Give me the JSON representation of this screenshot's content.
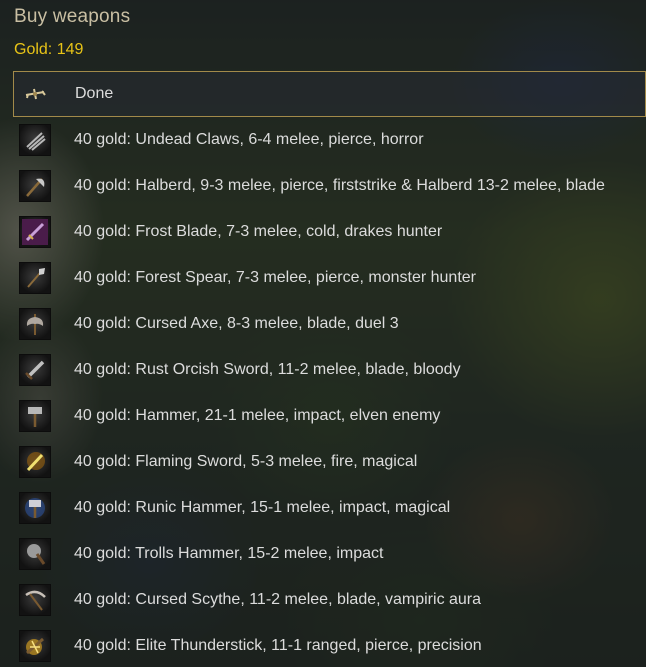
{
  "dialog": {
    "title": "Buy weapons",
    "gold_label": "Gold: 149"
  },
  "colors": {
    "title": "#c9bfa3",
    "gold": "#e8c417",
    "selection_border": "#a28a4a",
    "item_text": "#dcdcdc"
  },
  "menu": {
    "items": [
      {
        "label": "Done",
        "icon": "done-crossbow-icon",
        "selected": true
      },
      {
        "label": "40 gold: Undead Claws, 6-4 melee, pierce, horror",
        "icon": "claws-icon"
      },
      {
        "label": "40 gold: Halberd, 9-3 melee, pierce, firststrike & Halberd 13-2 melee, blade",
        "icon": "halberd-icon"
      },
      {
        "label": "40 gold: Frost Blade, 7-3 melee, cold, drakes hunter",
        "icon": "frost-blade-icon"
      },
      {
        "label": "40 gold: Forest Spear, 7-3 melee, pierce, monster hunter",
        "icon": "spear-icon"
      },
      {
        "label": "40 gold: Cursed Axe, 8-3 melee, blade, duel 3",
        "icon": "axe-icon"
      },
      {
        "label": "40 gold: Rust Orcish Sword, 11-2 melee, blade, bloody",
        "icon": "sword-icon"
      },
      {
        "label": "40 gold: Hammer, 21-1 melee, impact, elven enemy",
        "icon": "hammer-icon"
      },
      {
        "label": "40 gold: Flaming Sword, 5-3 melee, fire, magical",
        "icon": "flaming-sword-icon"
      },
      {
        "label": "40 gold: Runic Hammer, 15-1 melee, impact, magical",
        "icon": "runic-hammer-icon"
      },
      {
        "label": "40 gold: Trolls Hammer, 15-2 melee, impact",
        "icon": "troll-hammer-icon"
      },
      {
        "label": "40 gold: Cursed Scythe, 11-2 melee, blade, vampiric aura",
        "icon": "scythe-icon"
      },
      {
        "label": "40 gold: Elite Thunderstick, 11-1 ranged, pierce, precision",
        "icon": "thunderstick-icon"
      }
    ]
  }
}
